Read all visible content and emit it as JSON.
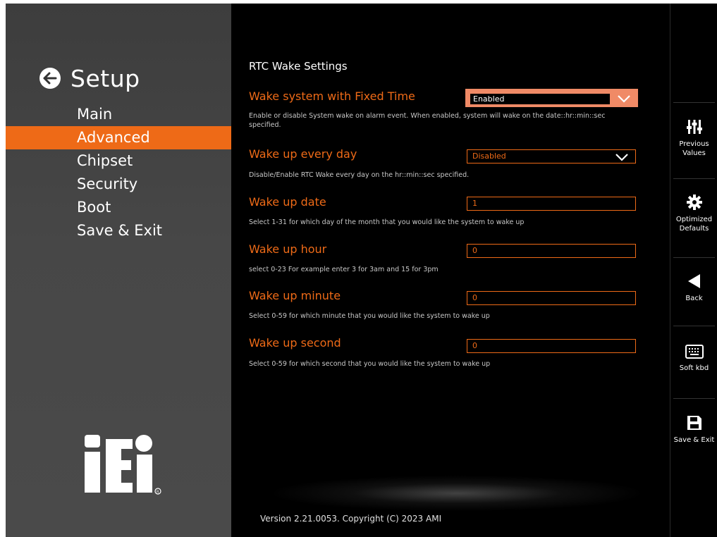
{
  "sidebar": {
    "title": "Setup",
    "menu": [
      "Main",
      "Advanced",
      "Chipset",
      "Security",
      "Boot",
      "Save & Exit"
    ],
    "active_index": 1,
    "logo_text": "iEi"
  },
  "main": {
    "section_title": "RTC Wake Settings",
    "rows": [
      {
        "label": "Wake system with Fixed Time",
        "value": "Enabled",
        "description": "Enable or disable System wake on alarm event. When enabled, system will wake on the date::hr::min::sec specified."
      },
      {
        "label": "Wake up every day",
        "value": "Disabled",
        "description": "Disable/Enable RTC Wake every day on the hr::min::sec specified."
      },
      {
        "label": "Wake up date",
        "value": "1",
        "description": "Select 1-31 for which day of the month that you would like the system to wake up"
      },
      {
        "label": "Wake up hour",
        "value": "0",
        "description": "select 0-23 For example enter 3 for 3am and 15 for 3pm"
      },
      {
        "label": "Wake up minute",
        "value": "0",
        "description": "Select 0-59 for which minute that you would like the system to wake up"
      },
      {
        "label": "Wake up second",
        "value": "0",
        "description": "Select 0-59 for which second that you would like the system to wake up"
      }
    ],
    "version": "Version 2.21.0053. Copyright (C) 2023 AMI"
  },
  "toolbar": {
    "previous_values": "Previous Values",
    "optimized_defaults": "Optimized Defaults",
    "back": "Back",
    "soft_kbd": "Soft kbd",
    "save_exit": "Save & Exit"
  },
  "colors": {
    "accent": "#ee6a17",
    "highlight_fill": "#f08a66",
    "sidebar_bg": "#444444"
  }
}
